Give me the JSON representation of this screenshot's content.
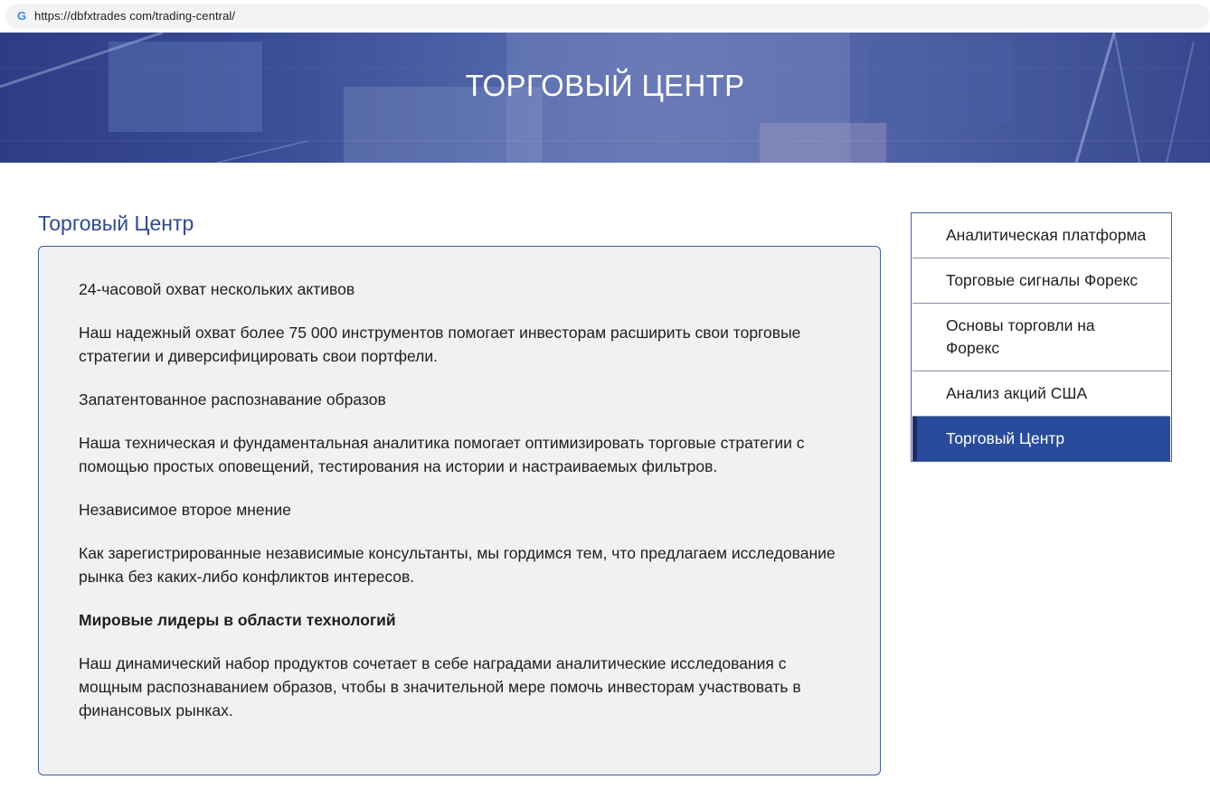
{
  "browser": {
    "url": "https://dbfxtrades com/trading-central/"
  },
  "hero": {
    "title": "ТОРГОВЫЙ ЦЕНТР"
  },
  "main": {
    "heading": "Торговый Центр",
    "paragraphs": [
      "24-часовой охват нескольких активов",
      "Наш надежный охват более 75 000 инструментов помогает инвесторам расширить свои торговые стратегии и диверсифицировать свои портфели.",
      "Запатентованное распознавание образов",
      "Наша техническая и фундаментальная аналитика помогает оптимизировать торговые стратегии с помощью простых оповещений, тестирования на истории и настраиваемых фильтров.",
      "Независимое второе мнение",
      "Как зарегистрированные независимые консультанты, мы гордимся тем, что предлагаем исследование рынка без каких-либо конфликтов интересов.",
      "Мировые лидеры в области технологий",
      "Наш динамический набор продуктов сочетает в себе наградами аналитические исследования с мощным распознаванием образов, чтобы в значительной мере помочь инвесторам участвовать в финансовых рынках."
    ]
  },
  "sidebar": {
    "items": [
      {
        "label": "Аналитическая платформа",
        "active": false
      },
      {
        "label": "Торговые сигналы Форекс",
        "active": false
      },
      {
        "label": "Основы торговли на Форекс",
        "active": false
      },
      {
        "label": "Анализ акций США",
        "active": false
      },
      {
        "label": "Торговый Центр",
        "active": true
      }
    ]
  },
  "colors": {
    "accent": "#284b9b",
    "heading": "#2e4a8e",
    "border": "#3f5d99"
  }
}
